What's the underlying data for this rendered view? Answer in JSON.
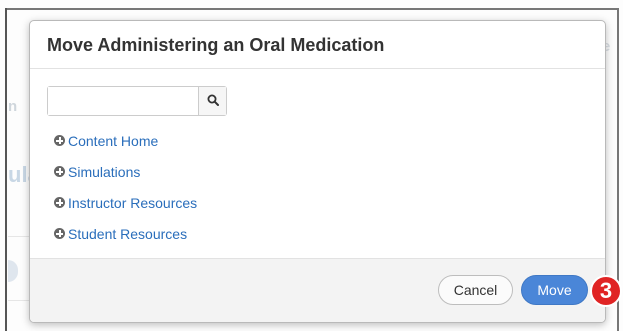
{
  "background": {
    "ghost_left_top": "n",
    "ghost_left_mid": "ula",
    "ghost_right_top": "e"
  },
  "modal": {
    "title": "Move Administering an Oral Medication",
    "search": {
      "value": "",
      "placeholder": ""
    },
    "search_icon": "search-icon",
    "tree_icon": "plus-circle-icon",
    "tree_items": [
      {
        "label": "Content Home"
      },
      {
        "label": "Simulations"
      },
      {
        "label": "Instructor Resources"
      },
      {
        "label": "Student Resources"
      }
    ],
    "footer": {
      "cancel_label": "Cancel",
      "move_label": "Move"
    }
  },
  "step_badge": {
    "label": "3"
  },
  "colors": {
    "link": "#2a6ebb",
    "primary_button": "#4a86d8",
    "badge": "#e02424",
    "footer_bg": "#f3f3f3"
  }
}
